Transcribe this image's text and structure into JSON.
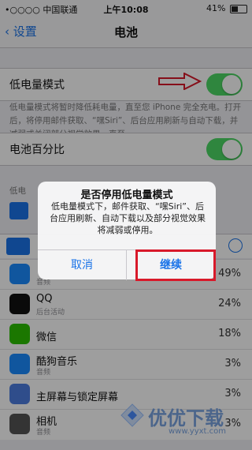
{
  "status_bar": {
    "carrier": "•○○○○ 中国联通 ",
    "time": "上午10:08",
    "battery": "41%"
  },
  "nav": {
    "back_label": "设置",
    "title": "电池"
  },
  "low_power": {
    "label": "低电量模式",
    "enabled": true,
    "description": "低电量模式将暂时降低耗电量，直至您 iPhone 完全充电。打开后，将停用邮件获取、“嘿Siri”、后台应用刷新与自动下载，并减弱或关闭部分视觉效果，直至。"
  },
  "battery_percentage": {
    "label": "电池百分比",
    "enabled": true
  },
  "usage_section": {
    "label": "低电"
  },
  "dialog": {
    "title": "是否停用低电量模式",
    "message": "低电量模式下，邮件获取、“嘿Siri”、后台应用刷新、自动下载以及部分视觉效果将减弱或停用。",
    "cancel": "取消",
    "confirm": "继续"
  },
  "apps": [
    {
      "name": "",
      "sub": "音频",
      "pct": "49%",
      "icon": "safari-icon",
      "color": "#1a8cff"
    },
    {
      "name": "QQ",
      "sub": "后台活动",
      "pct": "24%",
      "icon": "qq-icon",
      "color": "#111111"
    },
    {
      "name": "微信",
      "sub": "",
      "pct": "18%",
      "icon": "wechat-icon",
      "color": "#2dc100"
    },
    {
      "name": "酷狗音乐",
      "sub": "音频",
      "pct": "3%",
      "icon": "kugou-icon",
      "color": "#1a8cff"
    },
    {
      "name": "主屏幕与锁定屏幕",
      "sub": "",
      "pct": "3%",
      "icon": "home-grid-icon",
      "color": "#4c7ce0"
    },
    {
      "name": "相机",
      "sub": "音频",
      "pct": "3%",
      "icon": "camera-icon",
      "color": "#555555"
    }
  ],
  "watermark": {
    "text": "优优下载",
    "site": "www.yyxt.com"
  }
}
